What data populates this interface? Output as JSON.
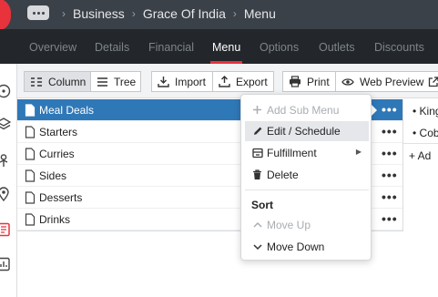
{
  "breadcrumb": {
    "items": [
      "Business",
      "Grace Of India",
      "Menu"
    ],
    "separator": "›"
  },
  "tabs": [
    {
      "label": "Overview",
      "active": false
    },
    {
      "label": "Details",
      "active": false
    },
    {
      "label": "Financial",
      "active": false
    },
    {
      "label": "Menu",
      "active": true
    },
    {
      "label": "Options",
      "active": false
    },
    {
      "label": "Outlets",
      "active": false
    },
    {
      "label": "Discounts",
      "active": false
    }
  ],
  "toolbar": {
    "column": "Column",
    "tree": "Tree",
    "import": "Import",
    "export": "Export",
    "print": "Print",
    "web_preview": "Web Preview"
  },
  "menu_items": [
    {
      "label": "Meal Deals",
      "selected": true
    },
    {
      "label": "Starters",
      "selected": false
    },
    {
      "label": "Curries",
      "selected": false
    },
    {
      "label": "Sides",
      "selected": false
    },
    {
      "label": "Desserts",
      "selected": false
    },
    {
      "label": "Drinks",
      "selected": false
    }
  ],
  "more_glyph": "•••",
  "right_panel": {
    "items": [
      "• King",
      "• Cob"
    ],
    "add_label": "+ Ad"
  },
  "context_menu": {
    "add_sub_menu": "Add Sub Menu",
    "edit_schedule": "Edit / Schedule",
    "fulfillment": "Fulfillment",
    "delete": "Delete",
    "sort_heading": "Sort",
    "move_up": "Move Up",
    "move_down": "Move Down",
    "submenu_arrow": "▶"
  },
  "colors": {
    "topbar": "#3b4148",
    "tabbar": "#23272b",
    "accent_red": "#e8323c",
    "selected_row": "#2f78b8"
  }
}
